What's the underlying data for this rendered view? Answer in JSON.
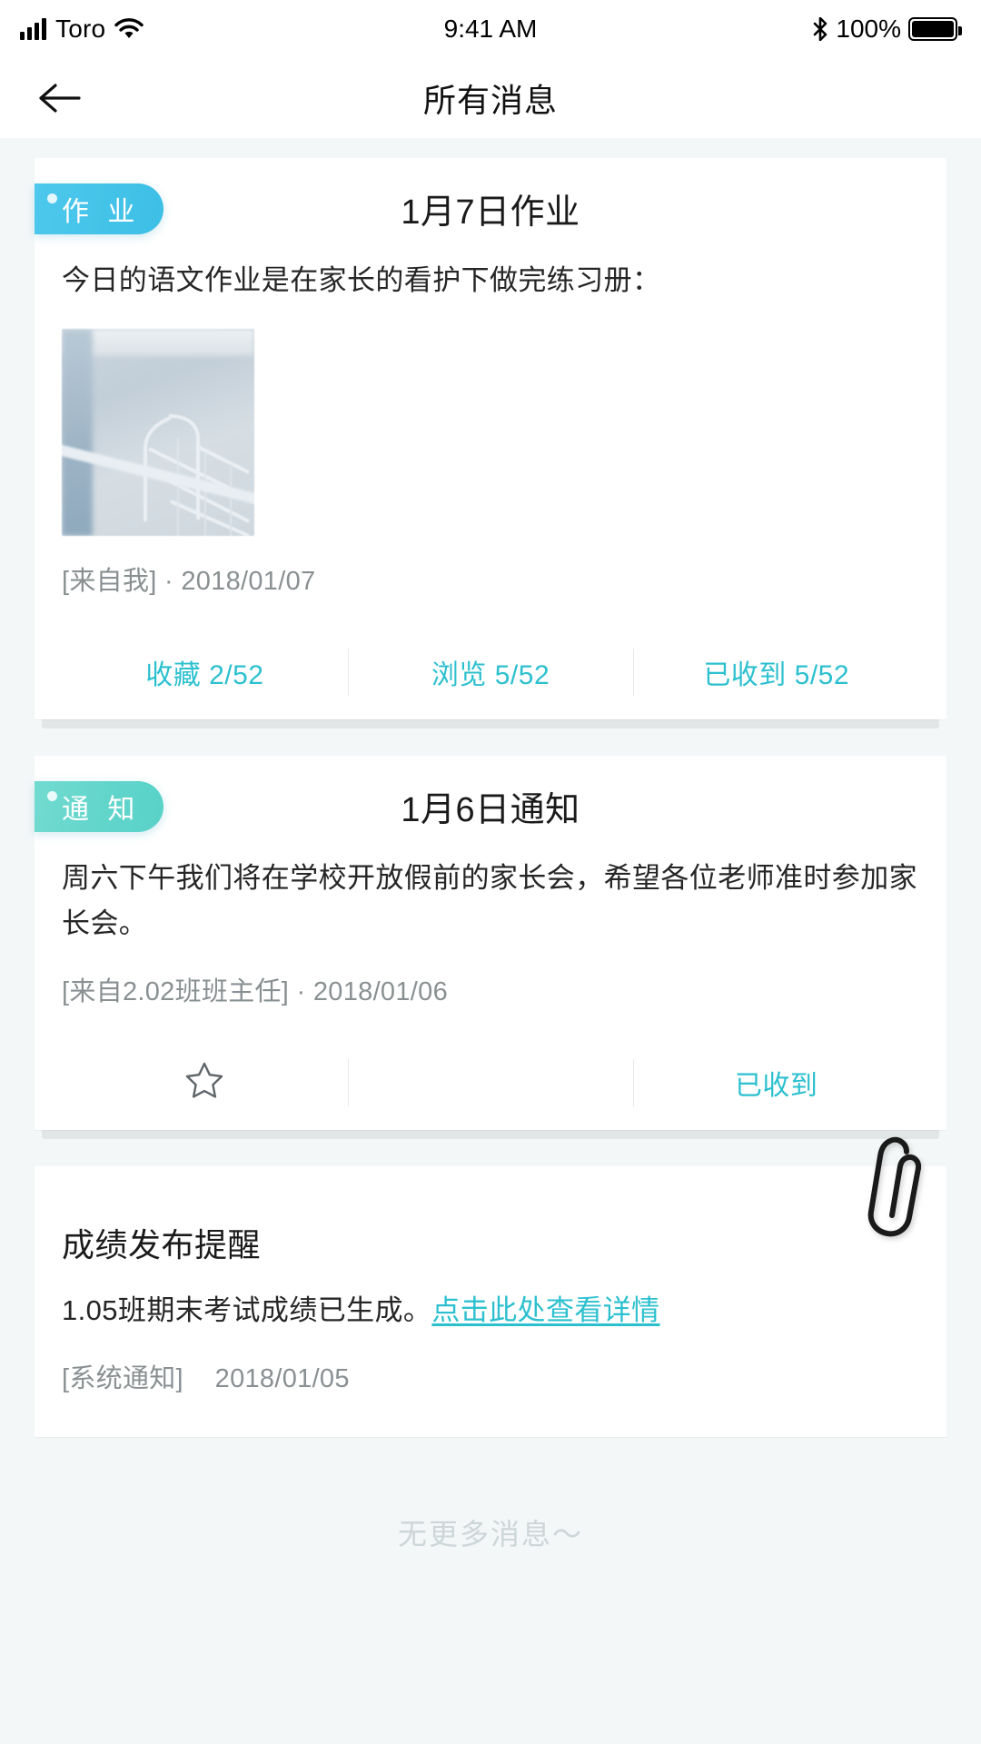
{
  "status_bar": {
    "carrier": "Toro",
    "time": "9:41 AM",
    "battery_percent": "100%",
    "icons": [
      "signal-icon",
      "wifi-icon",
      "bluetooth-icon",
      "battery-icon"
    ]
  },
  "nav": {
    "back_icon": "back-arrow-icon",
    "title": "所有消息"
  },
  "theme": {
    "accent": "#2cc0cf",
    "badge_blue": "#44c3e8",
    "badge_green": "#62d5cb",
    "page_bg": "#f4f7f8",
    "card_bg": "#ffffff",
    "meta_text": "#8a9092",
    "body_text": "#262626"
  },
  "messages": [
    {
      "badge": "作 业",
      "badge_type": "homework",
      "title": "1月7日作业",
      "text": "今日的语文作业是在家长的看护下做完练习册：",
      "has_image": true,
      "image_alt": "作业图片",
      "source": "[来自我]",
      "separator": "·",
      "date": "2018/01/07",
      "actions": [
        {
          "label": "收藏",
          "count": "2/52",
          "icon": null
        },
        {
          "label": "浏览",
          "count": "5/52",
          "icon": null
        },
        {
          "label": "已收到",
          "count": "5/52",
          "icon": null
        }
      ]
    },
    {
      "badge": "通 知",
      "badge_type": "notice",
      "title": "1月6日通知",
      "text": "周六下午我们将在学校开放假前的家长会，希望各位老师准时参加家长会。",
      "has_image": false,
      "source": "[来自2.02班班主任]",
      "separator": "·",
      "date": "2018/01/06",
      "actions": [
        {
          "label": "",
          "count": "",
          "icon": "star-outline-icon"
        },
        {
          "label": "",
          "count": "",
          "icon": null
        },
        {
          "label": "已收到",
          "count": "",
          "icon": null
        }
      ]
    },
    {
      "badge": null,
      "badge_type": "system",
      "title": "成绩发布提醒",
      "text": "1.05班期末考试成绩已生成。",
      "link_text": "点击此处查看详情",
      "has_image": false,
      "attachment_icon": "paperclip-icon",
      "source": "[系统通知]",
      "separator": " ",
      "date": "2018/01/05",
      "actions": []
    }
  ],
  "list_end": "无更多消息～"
}
